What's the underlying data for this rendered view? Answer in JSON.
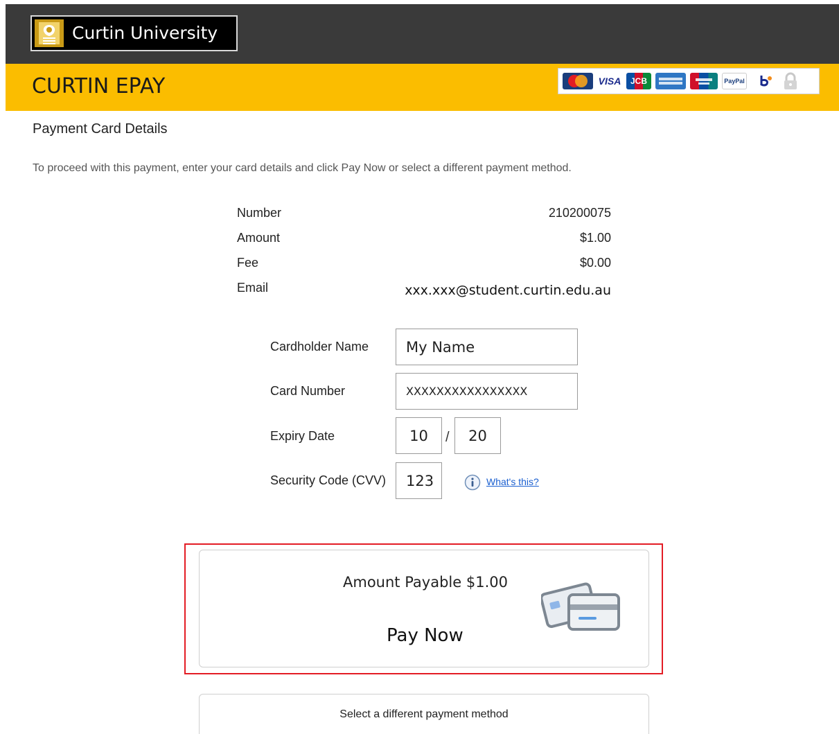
{
  "header": {
    "university_name": "Curtin University",
    "logo_icon": "shield-crest-icon",
    "colors": {
      "top_bar": "#3a3a3a",
      "accent": "#fbbd00",
      "crest": "#c99a16"
    }
  },
  "banner": {
    "title": "CURTIN EPAY",
    "accepted_cards": [
      "MasterCard",
      "VISA",
      "JCB",
      "American Express",
      "UnionPay",
      "PayPal",
      "BPOINT"
    ],
    "secure_icon": "padlock-icon"
  },
  "page": {
    "section_title": "Payment Card Details",
    "intro": "To proceed with this payment, enter your card details and click Pay Now or select a different payment method."
  },
  "summary": {
    "number_label": "Number",
    "number_value": "210200075",
    "amount_label": "Amount",
    "amount_value": "$1.00",
    "fee_label": "Fee",
    "fee_value": "$0.00",
    "email_label": "Email",
    "email_value": "xxx.xxx@student.curtin.edu.au"
  },
  "form": {
    "cardholder_label": "Cardholder Name",
    "cardholder_value": "My Name",
    "card_number_label": "Card Number",
    "card_number_value": "XXXXXXXXXXXXXXXX",
    "expiry_label": "Expiry Date",
    "expiry_month": "10",
    "expiry_separator": "/",
    "expiry_year": "20",
    "cvv_label": "Security Code (CVV)",
    "cvv_value": "123",
    "help_link": "What's this?",
    "help_icon": "info-icon"
  },
  "pay": {
    "amount_payable": "Amount Payable $1.00",
    "pay_now": "Pay Now",
    "icon": "credit-card-icon",
    "highlight_color": "#e31c24"
  },
  "alternative": {
    "label": "Select a different payment method"
  }
}
